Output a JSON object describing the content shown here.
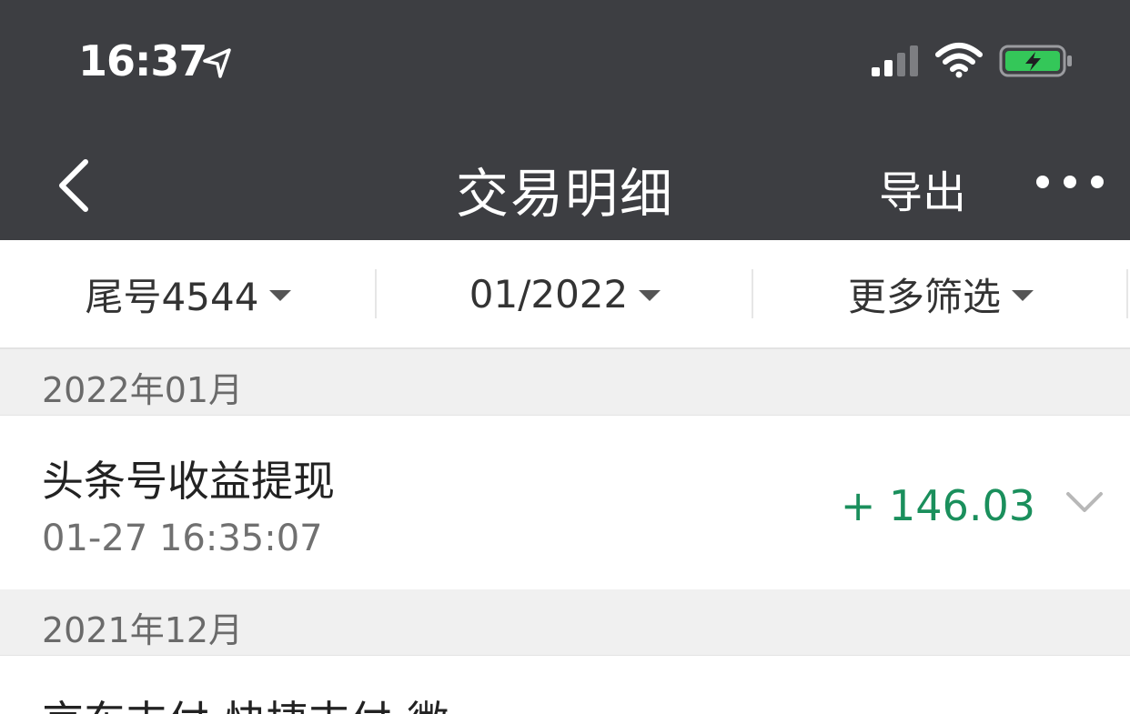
{
  "status_bar": {
    "time": "16:37"
  },
  "nav": {
    "title": "交易明细",
    "export_label": "导出"
  },
  "filters": [
    {
      "label": "尾号4544"
    },
    {
      "label": "01/2022"
    },
    {
      "label": "更多筛选"
    }
  ],
  "sections": [
    {
      "month": "2022年01月",
      "transactions": [
        {
          "title": "头条号收益提现",
          "time": "01-27 16:35:07",
          "amount": "+ 146.03"
        }
      ]
    },
    {
      "month": "2021年12月",
      "transactions": [
        {
          "title": "京东支付-快捷支付-微",
          "time": "",
          "amount": ""
        }
      ]
    }
  ],
  "colors": {
    "header_bg": "#3d3e42",
    "income_green": "#1a8f5c",
    "section_bg": "#f0f0f0",
    "battery_green": "#34c759"
  },
  "icons": {
    "status_bar": [
      "location-arrow-icon",
      "cellular-signal-icon",
      "wifi-icon",
      "battery-charging-icon"
    ],
    "nav": [
      "back-chevron-icon",
      "more-dots-icon"
    ],
    "row": [
      "chevron-down-icon"
    ]
  }
}
